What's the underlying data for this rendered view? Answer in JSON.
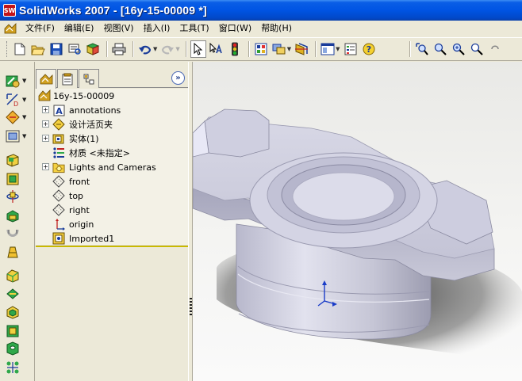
{
  "window": {
    "title": "SolidWorks 2007 - [16y-15-00009 *]",
    "logo_text": "SW"
  },
  "menu": {
    "items": [
      {
        "label": "文件(F)"
      },
      {
        "label": "编辑(E)"
      },
      {
        "label": "视图(V)"
      },
      {
        "label": "插入(I)"
      },
      {
        "label": "工具(T)"
      },
      {
        "label": "窗口(W)"
      },
      {
        "label": "帮助(H)"
      }
    ]
  },
  "feature_tree": {
    "root": "16y-15-00009",
    "items": [
      {
        "label": "annotations",
        "expandable": true,
        "icon": "annotation-icon"
      },
      {
        "label": "设计活页夹",
        "expandable": true,
        "icon": "design-binder-icon"
      },
      {
        "label": "实体(1)",
        "expandable": true,
        "icon": "solid-body-icon"
      },
      {
        "label": "材质 <未指定>",
        "expandable": false,
        "icon": "material-icon"
      },
      {
        "label": "Lights and Cameras",
        "expandable": true,
        "icon": "lights-cameras-icon"
      },
      {
        "label": "front",
        "expandable": false,
        "icon": "plane-icon"
      },
      {
        "label": "top",
        "expandable": false,
        "icon": "plane-icon"
      },
      {
        "label": "right",
        "expandable": false,
        "icon": "plane-icon"
      },
      {
        "label": "origin",
        "expandable": false,
        "icon": "origin-icon"
      },
      {
        "label": "Imported1",
        "expandable": false,
        "icon": "imported-feature-icon"
      }
    ]
  },
  "colors": {
    "title_bar": "#0054e3",
    "panel_bg": "#ece9d8",
    "tree_bg": "#f3f1e6",
    "rollback_bar": "#d4c400",
    "model_surface": "#c8c8dc"
  }
}
